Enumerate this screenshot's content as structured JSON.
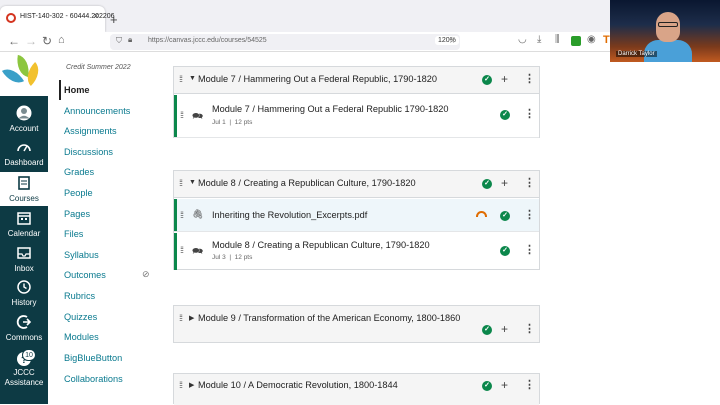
{
  "browser": {
    "tab_title": "HIST-140-302 - 60444.202206",
    "tab_close": "×",
    "new_tab": "+",
    "url": "https://canvas.jccc.edu/courses/54525",
    "zoom": "120%"
  },
  "webcam": {
    "name": "Darrick Taylor"
  },
  "global_nav": {
    "items": [
      {
        "label": "Account"
      },
      {
        "label": "Dashboard"
      },
      {
        "label": "Courses"
      },
      {
        "label": "Calendar"
      },
      {
        "label": "Inbox"
      },
      {
        "label": "History"
      },
      {
        "label": "Commons"
      },
      {
        "label": "JCCC Assistance",
        "badge": "10"
      }
    ]
  },
  "course_nav": {
    "term": "Credit Summer 2022",
    "items": [
      "Home",
      "Announcements",
      "Assignments",
      "Discussions",
      "Grades",
      "People",
      "Pages",
      "Files",
      "Syllabus",
      "Outcomes",
      "Rubrics",
      "Quizzes",
      "Modules",
      "BigBlueButton",
      "Collaborations"
    ]
  },
  "modules": [
    {
      "title": "Module 7 / Hammering Out a Federal Republic, 1790-1820",
      "items": [
        {
          "title": "Module 7 / Hammering Out a Federal Republic 1790-1820",
          "date": "Jul 1",
          "points": "12 pts"
        }
      ]
    },
    {
      "title": "Module 8 / Creating a Republican Culture, 1790-1820",
      "items": [
        {
          "title": "Inheriting the Revolution_Excerpts.pdf"
        },
        {
          "title": "Module 8 / Creating a Republican Culture, 1790-1820",
          "date": "Jul 3",
          "points": "12 pts"
        }
      ]
    },
    {
      "title": "Module 9 / Transformation of the American Economy, 1800-1860"
    },
    {
      "title": "Module 10 / A Democratic Revolution, 1800-1844"
    }
  ],
  "colors": {
    "nav_bg": "#0d3a44",
    "link": "#0a7a8f",
    "success": "#0b874b",
    "warning": "#e06c00"
  }
}
